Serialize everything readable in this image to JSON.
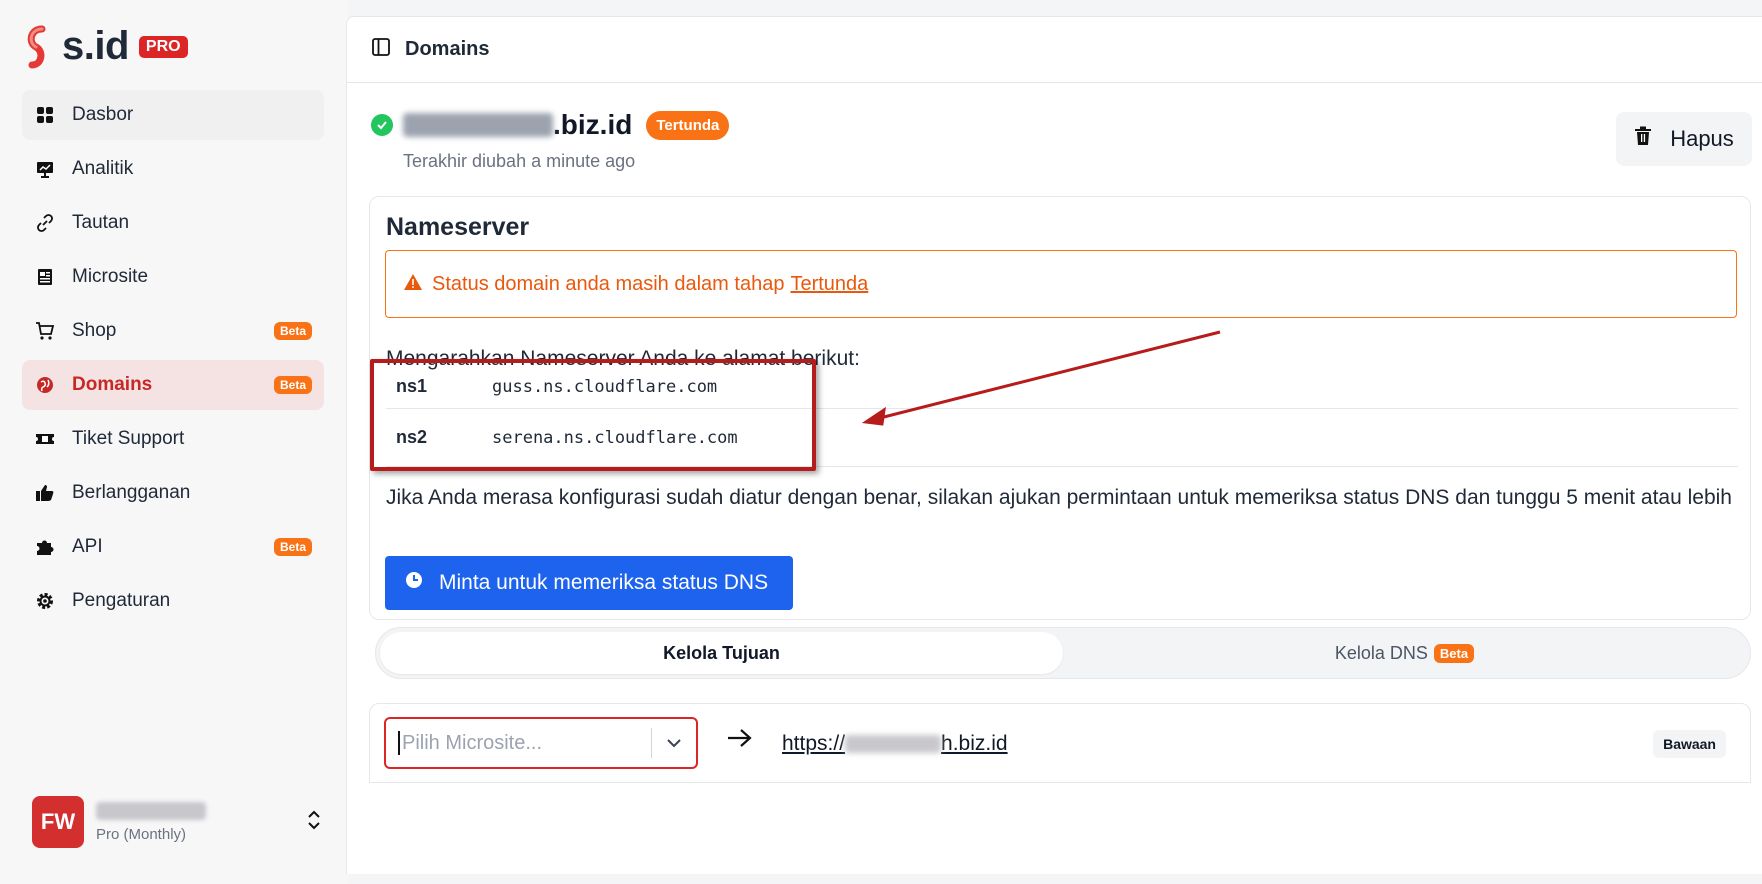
{
  "brand": {
    "name": "s.id",
    "badge": "PRO"
  },
  "sidebar": {
    "items": [
      {
        "label": "Dasbor",
        "icon": "dashboard-icon"
      },
      {
        "label": "Analitik",
        "icon": "analytics-icon"
      },
      {
        "label": "Tautan",
        "icon": "link-icon"
      },
      {
        "label": "Microsite",
        "icon": "microsite-icon"
      },
      {
        "label": "Shop",
        "icon": "cart-icon",
        "badge": "Beta"
      },
      {
        "label": "Domains",
        "icon": "globe-icon",
        "badge": "Beta",
        "active": true
      },
      {
        "label": "Tiket Support",
        "icon": "ticket-icon"
      },
      {
        "label": "Berlangganan",
        "icon": "thumbs-up-icon"
      },
      {
        "label": "API",
        "icon": "puzzle-icon",
        "badge": "Beta"
      },
      {
        "label": "Pengaturan",
        "icon": "gear-icon"
      }
    ]
  },
  "user": {
    "initials": "FW",
    "plan": "Pro (Monthly)"
  },
  "header": {
    "title": "Domains"
  },
  "domain": {
    "suffix": ".biz.id",
    "status": "Tertunda",
    "updated": "Terakhir diubah a minute ago",
    "delete_label": "Hapus"
  },
  "nameserver": {
    "title": "Nameserver",
    "alert_text": "Status domain anda masih dalam tahap",
    "alert_link": "Tertunda",
    "direct_text": "Mengarahkan Nameserver Anda ke alamat berikut:",
    "rows": [
      {
        "key": "ns1",
        "value": "guss.ns.cloudflare.com"
      },
      {
        "key": "ns2",
        "value": "serena.ns.cloudflare.com"
      }
    ],
    "info_text": "Jika Anda merasa konfigurasi sudah diatur dengan benar, silakan ajukan permintaan untuk memeriksa status DNS dan tunggu 5 menit atau lebih",
    "check_button": "Minta untuk memeriksa status DNS"
  },
  "tabs": [
    {
      "label": "Kelola Tujuan",
      "active": true
    },
    {
      "label": "Kelola DNS",
      "badge": "Beta"
    }
  ],
  "destination": {
    "placeholder": "Pilih Microsite...",
    "url_prefix": "https://",
    "url_suffix": "h.biz.id",
    "default_label": "Bawaan"
  },
  "colors": {
    "brand_red": "#dc2626",
    "accent_orange": "#f97316",
    "primary_blue": "#1d63ed",
    "success_green": "#22c55e"
  }
}
